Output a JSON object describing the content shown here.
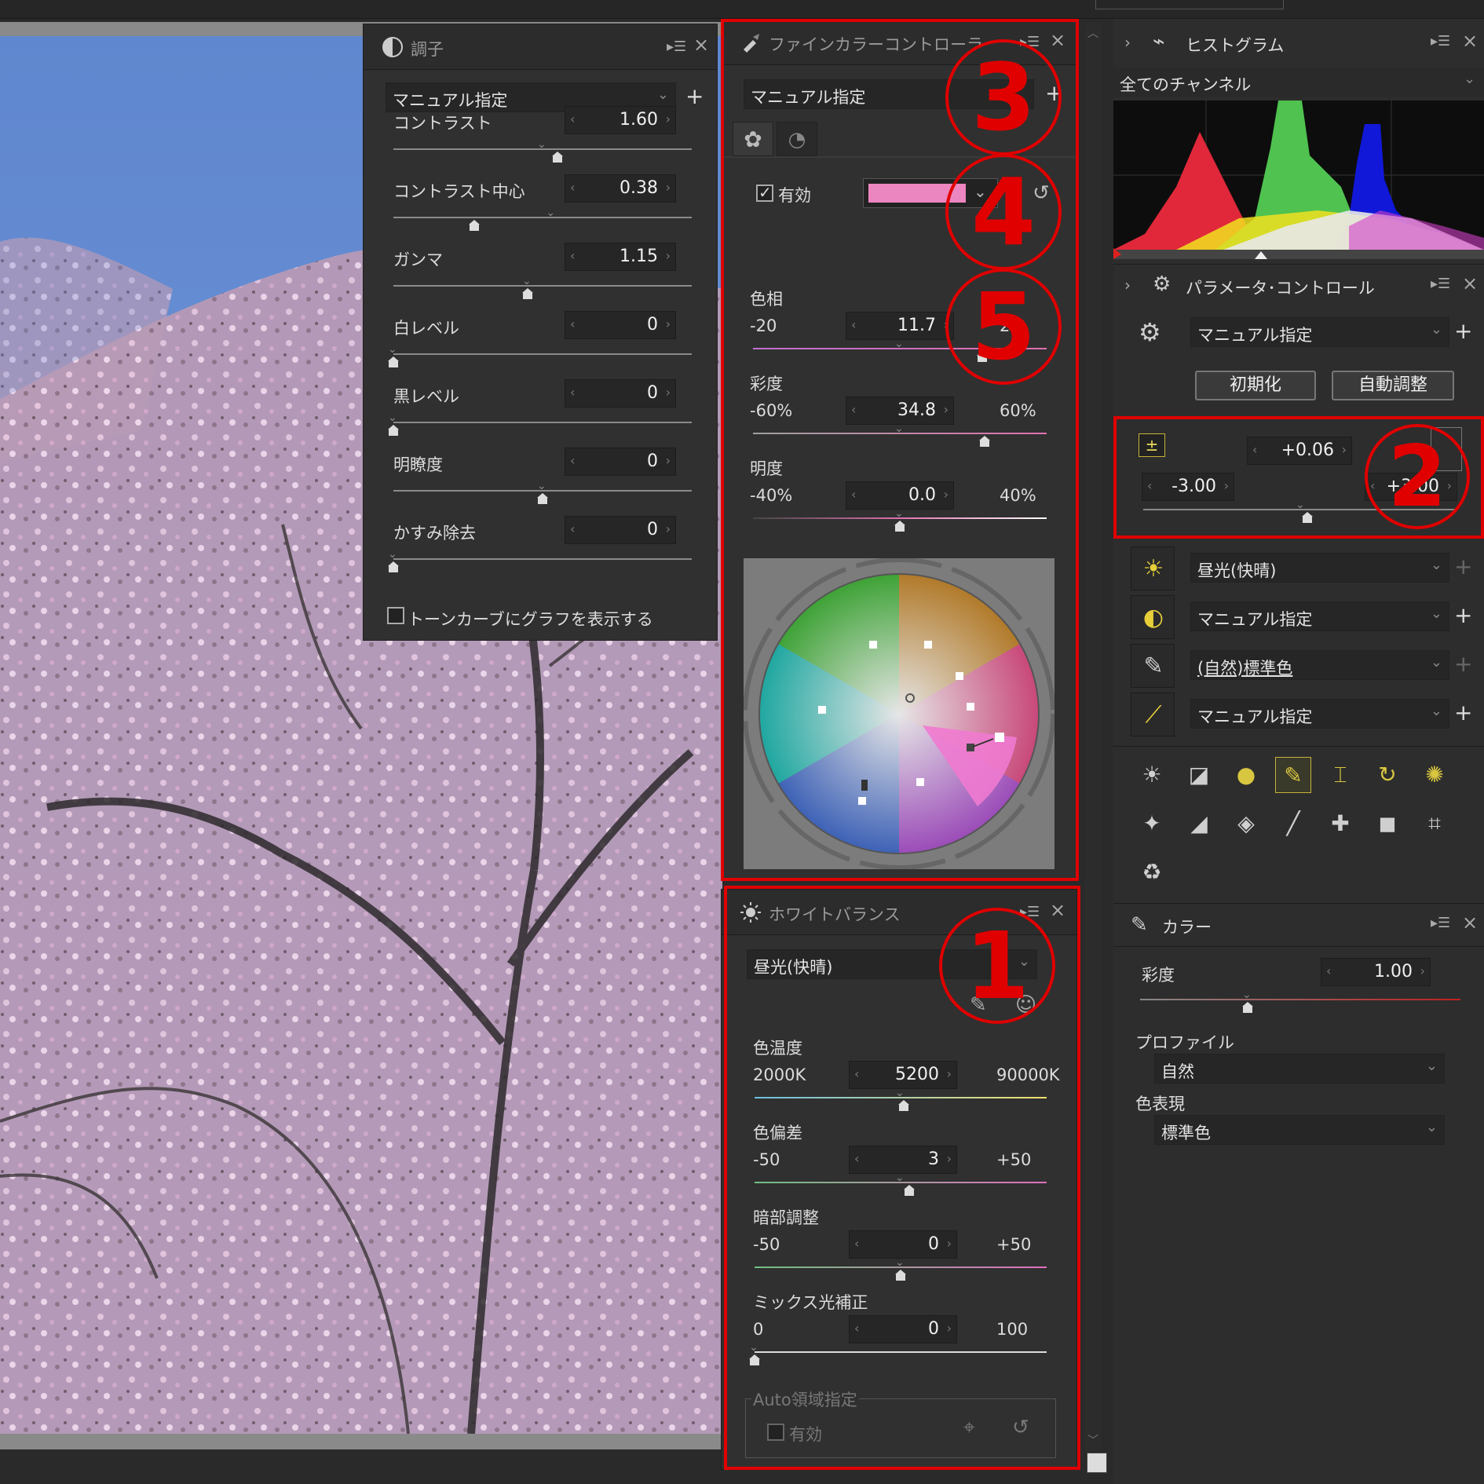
{
  "tone_panel": {
    "title": "調子",
    "preset": "マニュアル指定",
    "sliders": [
      {
        "label": "コントラスト",
        "value": "1.60"
      },
      {
        "label": "コントラスト中心",
        "value": "0.38"
      },
      {
        "label": "ガンマ",
        "value": "1.15"
      },
      {
        "label": "白レベル",
        "value": "0"
      },
      {
        "label": "黒レベル",
        "value": "0"
      },
      {
        "label": "明瞭度",
        "value": "0"
      },
      {
        "label": "かすみ除去",
        "value": "0"
      }
    ],
    "tone_curve_checkbox": "トーンカーブにグラフを表示する"
  },
  "fine_color": {
    "title": "ファインカラーコントローラ",
    "preset": "マニュアル指定",
    "enabled_label": "有効",
    "swatch_color": "#ec86c0",
    "hue": {
      "label": "色相",
      "min": "-20",
      "value": "11.7",
      "max": "20"
    },
    "saturation": {
      "label": "彩度",
      "min": "-60%",
      "value": "34.8",
      "max": "60%"
    },
    "brightness": {
      "label": "明度",
      "min": "-40%",
      "value": "0.0",
      "max": "40%"
    }
  },
  "white_balance": {
    "title": "ホワイトバランス",
    "preset": "昼光(快晴)",
    "temp": {
      "label": "色温度",
      "min": "2000K",
      "value": "5200",
      "max": "90000K"
    },
    "tint": {
      "label": "色偏差",
      "min": "-50",
      "value": "3",
      "max": "+50"
    },
    "shadow": {
      "label": "暗部調整",
      "min": "-50",
      "value": "0",
      "max": "+50"
    },
    "mixed": {
      "label": "ミックス光補正",
      "min": "0",
      "value": "0",
      "max": "100"
    },
    "auto_area": {
      "label": "Auto領域指定",
      "enabled_label": "有効"
    }
  },
  "histogram": {
    "title": "ヒストグラム",
    "channel": "全てのチャンネル"
  },
  "param_control": {
    "title": "パラメータ･コントロール",
    "preset": "マニュアル指定",
    "reset_button": "初期化",
    "auto_button": "自動調整",
    "exposure": {
      "value": "+0.06",
      "min": "-3.00",
      "max": "+3.00"
    },
    "rows": [
      {
        "icon": "sun-icon",
        "value": "昼光(快晴)"
      },
      {
        "icon": "contrast-icon",
        "value": "マニュアル指定"
      },
      {
        "icon": "eyedropper-icon",
        "value": "(自然)標準色"
      },
      {
        "icon": "wand-icon",
        "value": "マニュアル指定"
      }
    ]
  },
  "color_panel": {
    "title": "カラー",
    "saturation_label": "彩度",
    "saturation_value": "1.00",
    "profile_label": "プロファイル",
    "profile_value": "自然",
    "color_expr_label": "色表現",
    "color_expr_value": "標準色"
  },
  "annotations": [
    "1",
    "2",
    "3",
    "4",
    "5"
  ],
  "colors": {
    "annotation_red": "#e00000",
    "panel_bg": "#303030",
    "sky_blue": "#6a8fd0"
  }
}
